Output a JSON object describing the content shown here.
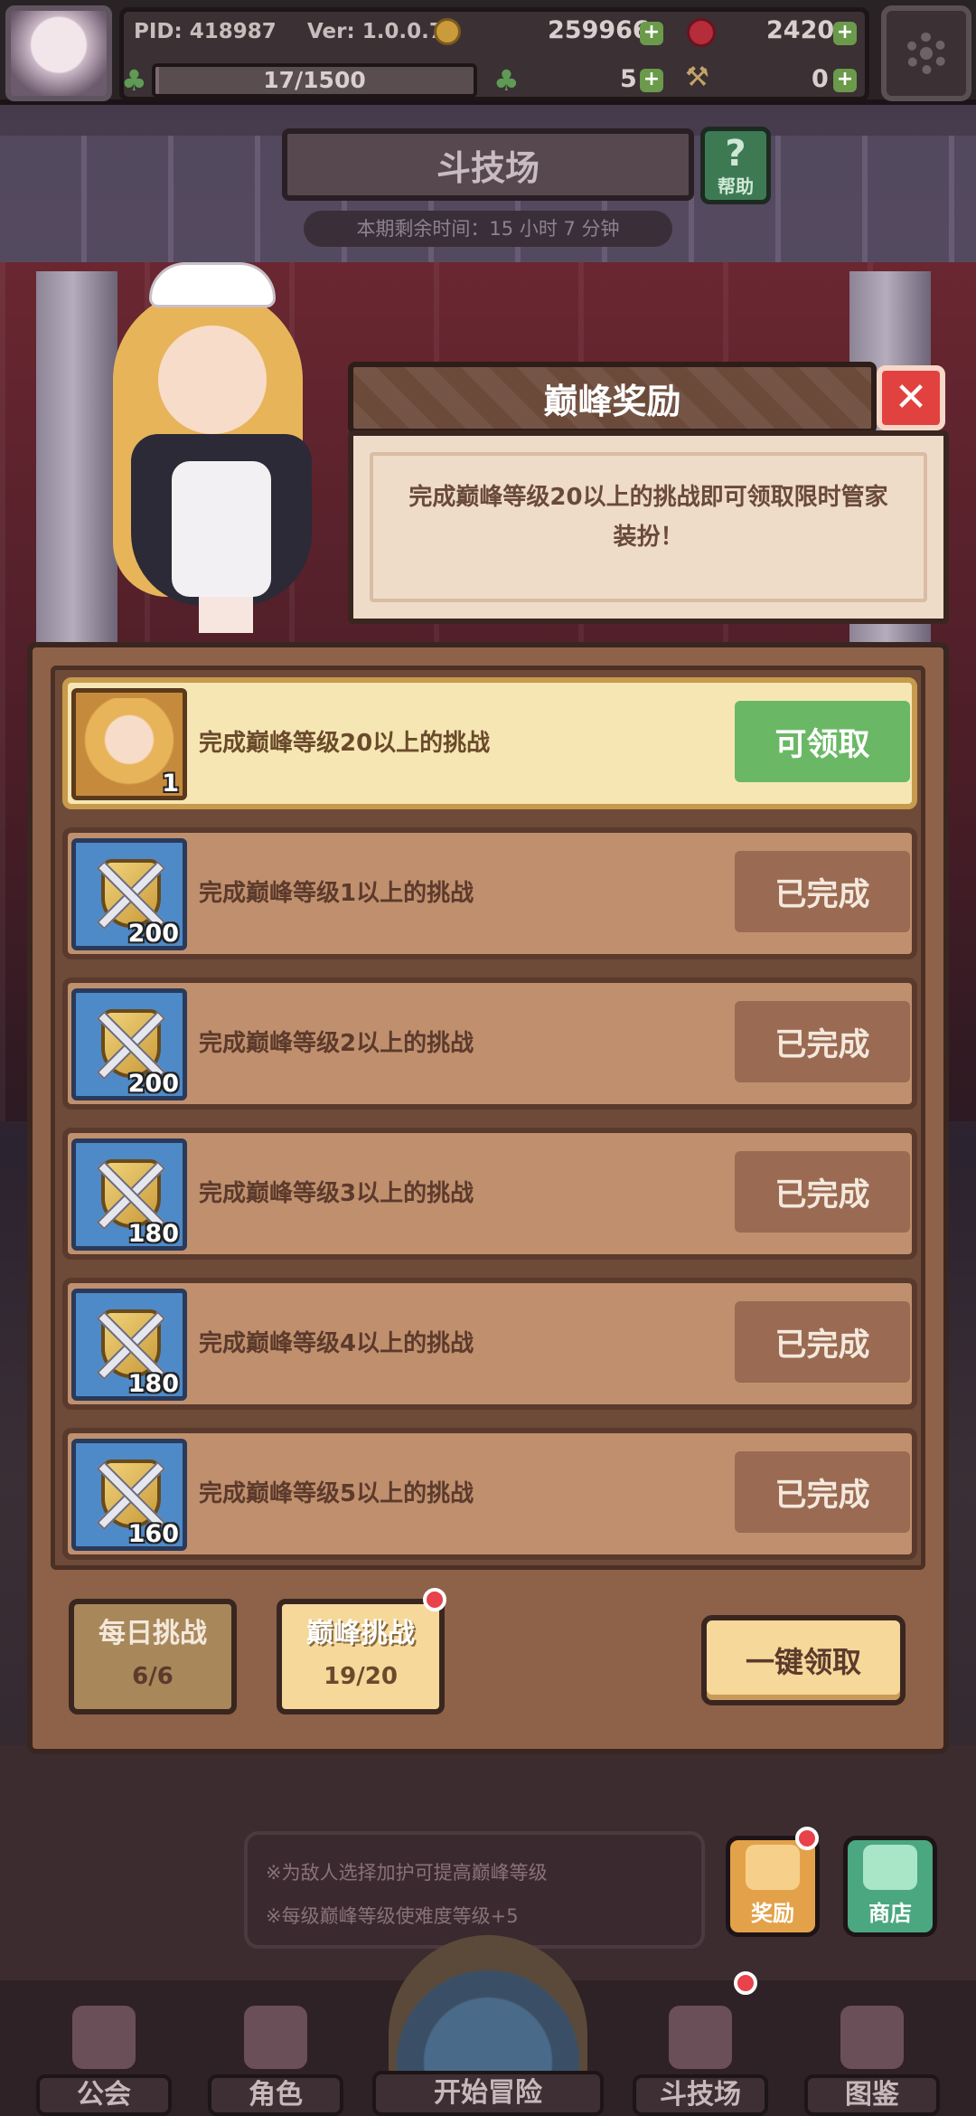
{
  "hud": {
    "pid": "PID: 418987",
    "version": "Ver: 1.0.0.7",
    "gold": "259966",
    "gems": "2420",
    "stamina": "17/1500",
    "stamina_fraction": 0.011,
    "clover_count": "5",
    "tool_count": "0",
    "plus": "+"
  },
  "arena": {
    "title": "斗技场",
    "help_label": "帮助",
    "help_glyph": "?",
    "time_left": "本期剩余时间：15 小时 7 分钟"
  },
  "popup": {
    "title": "巅峰奖励",
    "close_glyph": "✕",
    "message": "完成巅峰等级20以上的挑战即可领取限时管家装扮！"
  },
  "tasks": [
    {
      "text": "完成巅峰等级20以上的挑战",
      "qty": "1",
      "button": "可领取",
      "state": "claimable",
      "icon": "maid-portrait-icon"
    },
    {
      "text": "完成巅峰等级1以上的挑战",
      "qty": "200",
      "button": "已完成",
      "state": "done",
      "icon": "arena-badge-icon"
    },
    {
      "text": "完成巅峰等级2以上的挑战",
      "qty": "200",
      "button": "已完成",
      "state": "done",
      "icon": "arena-badge-icon"
    },
    {
      "text": "完成巅峰等级3以上的挑战",
      "qty": "180",
      "button": "已完成",
      "state": "done",
      "icon": "arena-badge-icon"
    },
    {
      "text": "完成巅峰等级4以上的挑战",
      "qty": "180",
      "button": "已完成",
      "state": "done",
      "icon": "arena-badge-icon"
    },
    {
      "text": "完成巅峰等级5以上的挑战",
      "qty": "160",
      "button": "已完成",
      "state": "done",
      "icon": "arena-badge-icon"
    }
  ],
  "tabs": {
    "daily": {
      "label": "每日挑战",
      "progress": "6/6"
    },
    "peak": {
      "label": "巅峰挑战",
      "progress": "19/20"
    }
  },
  "claim_all": "一键领取",
  "notes": [
    "※为敌人选择加护可提高巅峰等级",
    "※每级巅峰等级使难度等级+5"
  ],
  "side_buttons": {
    "reward": "奖励",
    "shop": "商店"
  },
  "nav": {
    "guild": "公会",
    "character": "角色",
    "start": "开始冒险",
    "arena": "斗技场",
    "codex": "图鉴"
  },
  "colors": {
    "claim_green": "#6ab866",
    "done_brown": "#9a6a52",
    "notify_red": "#e8424a",
    "close_red": "#e2423f"
  }
}
